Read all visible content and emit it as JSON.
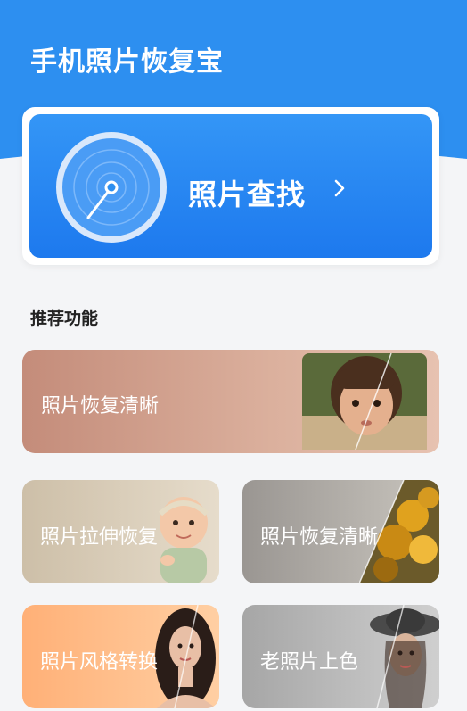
{
  "header": {
    "title": "手机照片恢复宝"
  },
  "search_card": {
    "label": "照片查找",
    "chevron": "chevron-right-icon",
    "icon": "radar-icon"
  },
  "section": {
    "title": "推荐功能"
  },
  "features": [
    {
      "label": "照片恢复清晰"
    },
    {
      "label": "照片拉伸恢复"
    },
    {
      "label": "照片恢复清晰"
    },
    {
      "label": "照片风格转换"
    },
    {
      "label": "老照片上色"
    }
  ],
  "colors": {
    "primary": "#2d8ff0",
    "card_blue": "#1d79ee",
    "background": "#f4f5f7"
  }
}
